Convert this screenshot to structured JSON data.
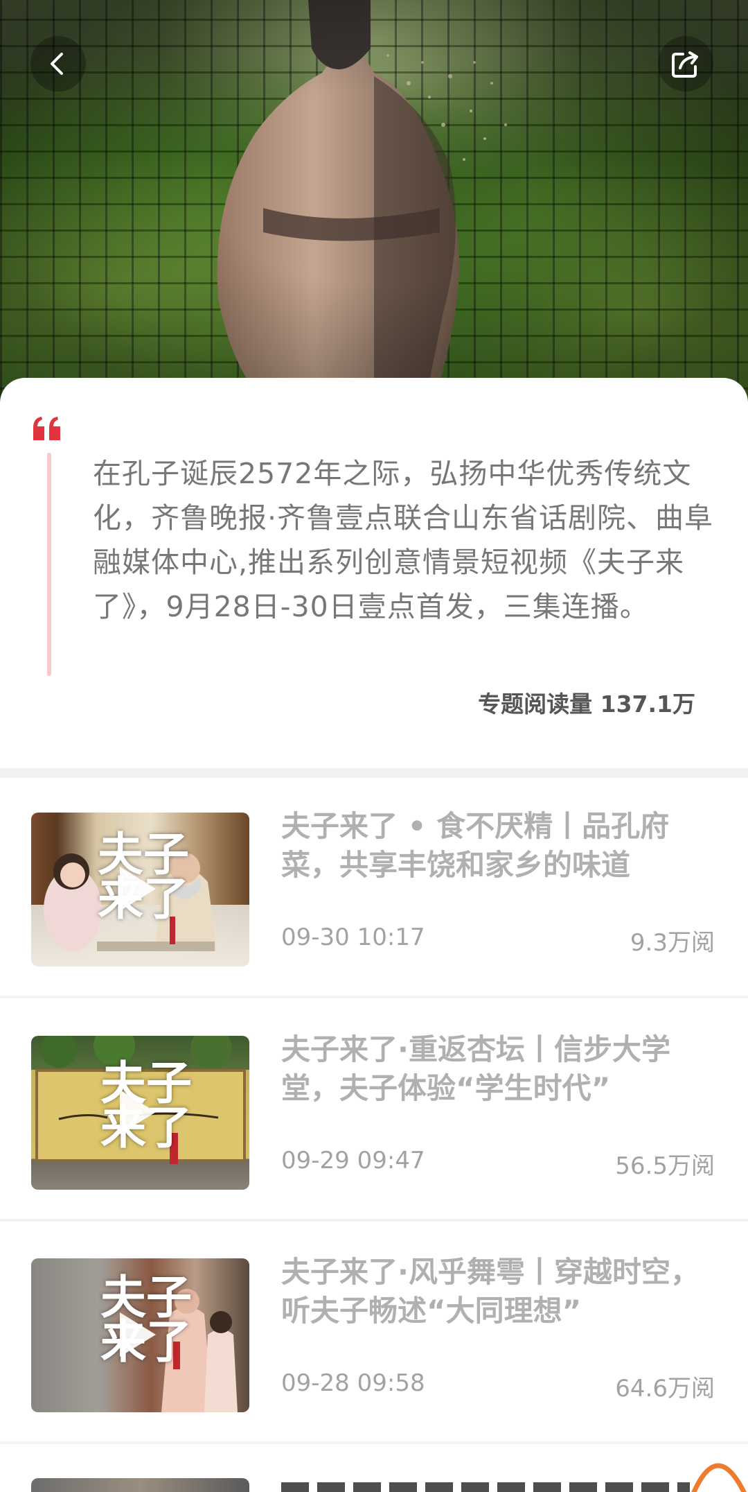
{
  "header": {
    "back_icon": "chevron-left-icon",
    "share_icon": "share-icon"
  },
  "intro": {
    "quote_icon": "quote-icon",
    "text": "在孔子诞辰2572年之际，弘扬中华优秀传统文化，齐鲁晚报·齐鲁壹点联合山东省话剧院、曲阜融媒体中心,推出系列创意情景短视频《夫子来了》，9月28日-30日壹点首发，三集连播。",
    "read_count": "专题阅读量 137.1万"
  },
  "articles": [
    {
      "title": "夫子来了 • 食不厌精丨品孔府菜，共享丰饶和家乡的味道",
      "date": "09-30 10:17",
      "views": "9.3万阅"
    },
    {
      "title": "夫子来了·重返杏坛丨信步大学堂，夫子体验“学生时代”",
      "date": "09-29 09:47",
      "views": "56.5万阅"
    },
    {
      "title": "夫子来了·风乎舞雩丨穿越时空，听夫子畅述“大同理想”",
      "date": "09-28 09:58",
      "views": "64.6万阅"
    }
  ],
  "thumb_overlay": {
    "line1": "夫子",
    "line2": "来了"
  },
  "colors": {
    "accent_red": "#e0353f",
    "quote_bar": "#f6c9cf",
    "muted_text": "#777777",
    "title_gray": "#b0b0b0",
    "scroll_top_orange": "#f07b2c"
  }
}
